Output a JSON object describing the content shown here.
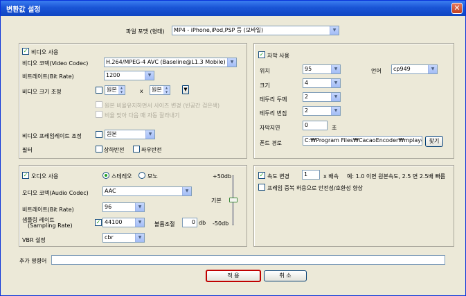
{
  "window": {
    "title": "변환값 설정"
  },
  "format": {
    "label": "파일 포맷 (형태)",
    "value": "MP4 - iPhone,iPod,PSP 등 (모바일)"
  },
  "video": {
    "enable_label": "비디오 사용",
    "codec_label": "비디오 코덱(Video Codec)",
    "codec_value": "H.264/MPEG-4 AVC (Baseline@L1.3 Mobile)",
    "bitrate_label": "비트레이트(Bit Rate)",
    "bitrate_value": "1200",
    "size_label": "비디오 크기 조정",
    "size_w": "원본",
    "size_x": "x",
    "size_h": "원본",
    "keep_ratio_label": "원본 비율유지하면서 사이즈 변경 (빈공간 검은색)",
    "crop_label": "비율 맞아 다음 때 자동 잘라내기",
    "framerate_label": "비디오 프레임레이트 조정",
    "framerate_value": "원본",
    "filter_label": "필터",
    "flip_v_label": "상하반전",
    "flip_h_label": "좌우반전"
  },
  "subtitle": {
    "enable_label": "자막 사용",
    "position_label": "위치",
    "position_value": "95",
    "language_label": "언어",
    "language_value": "cp949",
    "size_label": "크기",
    "size_value": "4",
    "border_thickness_label": "테두리 두께",
    "border_thickness_value": "2",
    "border_blur_label": "테두리 번짐",
    "border_blur_value": "2",
    "delay_label": "자막지연",
    "delay_value": "0",
    "delay_unit": "초",
    "font_path_label": "폰트 경로",
    "font_path_value": "C:₩Program Files₩CacaoEncoder₩mplayer",
    "find_button": "찾기"
  },
  "audio": {
    "enable_label": "오디오 사용",
    "stereo_label": "스테레오",
    "mono_label": "모노",
    "codec_label": "오디오 코덱(Audio Codec)",
    "codec_value": "AAC",
    "bitrate_label": "비트레이트(Bit Rate)",
    "bitrate_value": "96",
    "sampling_label_1": "샘플링 레이트",
    "sampling_label_2": "(Sampling Rate)",
    "sampling_value": "44100",
    "volume_label": "볼륨조절",
    "volume_value": "0",
    "volume_unit": "db",
    "vbr_label": "VBR 설정",
    "vbr_value": "cbr",
    "gain_top": "+50db",
    "gain_mid": "기본",
    "gain_bottom": "-50db",
    "gain_level_db": 0
  },
  "speed": {
    "enable_label": "속도 변경",
    "value": "1",
    "unit": "x 배속",
    "hint": "예: 1.0 이면 원본속도, 2.5 면 2.5배 빠름",
    "dup_frames_label": "프레임 중복 허용으로 안전성/호환성 향상"
  },
  "extra": {
    "label": "추가 명령어",
    "value": ""
  },
  "buttons": {
    "apply": "적 용",
    "cancel": "취 소"
  },
  "colors": {
    "accent_checked": "#21a121",
    "title_bar": "#1a55d6",
    "apply_border": "#c00000"
  }
}
